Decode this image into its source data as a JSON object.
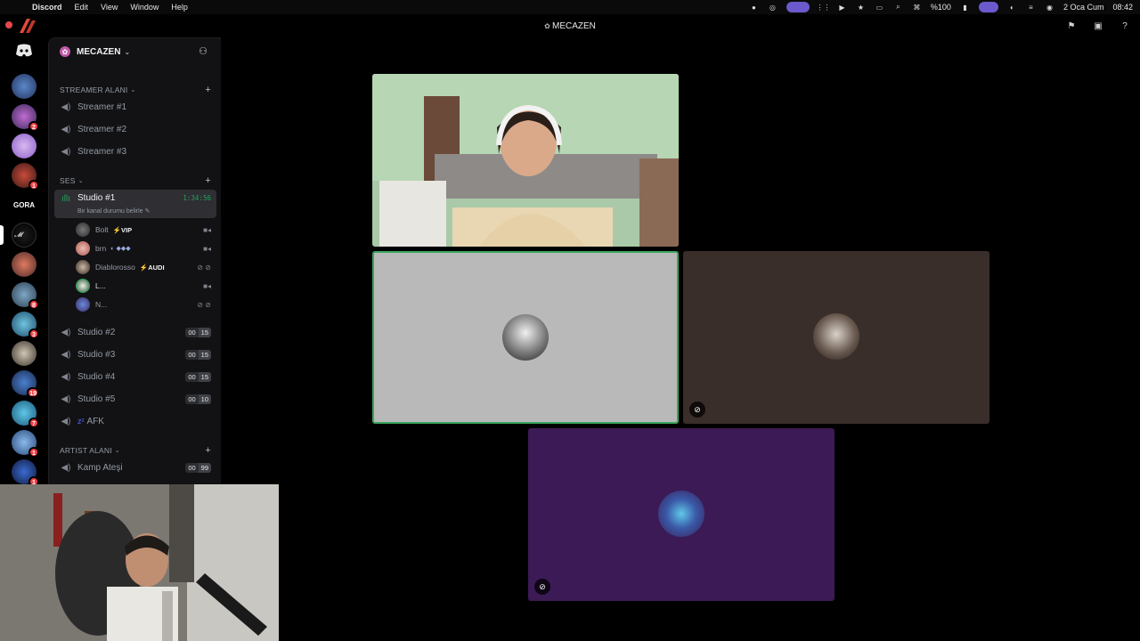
{
  "menubar": {
    "app": "Discord",
    "items": [
      "Edit",
      "View",
      "Window",
      "Help"
    ],
    "battery": "%100",
    "date": "2 Oca Cum",
    "time": "08:42"
  },
  "window": {
    "title": "MECAZEN"
  },
  "servers": [
    {
      "badge": ""
    },
    {
      "badge": "2"
    },
    {
      "badge": ""
    },
    {
      "badge": "1"
    },
    {
      "label": "GORA"
    },
    {
      "badge": ""
    },
    {
      "badge": ""
    },
    {
      "badge": "8"
    },
    {
      "badge": "3"
    },
    {
      "badge": ""
    },
    {
      "badge": "19"
    },
    {
      "badge": "7"
    },
    {
      "badge": "1"
    },
    {
      "badge": "1"
    }
  ],
  "guild": {
    "name": "MECAZEN"
  },
  "categories": {
    "streamer": "STREAMER ALANI",
    "ses": "SES",
    "artist": "ARTIST ALANI"
  },
  "channels": {
    "streamer1": "Streamer #1",
    "streamer2": "Streamer #2",
    "streamer3": "Streamer #3",
    "studio1": {
      "name": "Studio #1",
      "timer": "1:34:56",
      "status": "Bir kanal durumu belirle"
    },
    "studio2": {
      "name": "Studio #2",
      "a": "00",
      "b": "15"
    },
    "studio3": {
      "name": "Studio #3",
      "a": "00",
      "b": "15"
    },
    "studio4": {
      "name": "Studio #4",
      "a": "00",
      "b": "15"
    },
    "studio5": {
      "name": "Studio #5",
      "a": "00",
      "b": "10"
    },
    "afk": "AFK",
    "kamp": {
      "name": "Kamp Ateşi",
      "a": "00",
      "b": "99"
    }
  },
  "members": [
    {
      "name": "Bolt",
      "tag": "⚡VIP"
    },
    {
      "name": "brn",
      "tag": ""
    },
    {
      "name": "Diablorosso",
      "tag": "⚡AUDI"
    },
    {
      "name": "L...",
      "tag": ""
    },
    {
      "name": "N...",
      "tag": ""
    }
  ],
  "colors": {
    "accent_green": "#23a55a",
    "tile_gray": "#b9b9b9",
    "tile_brown": "#3a2e2a",
    "tile_purple": "#3b1a55",
    "speaking_border": "#3ba55c"
  }
}
